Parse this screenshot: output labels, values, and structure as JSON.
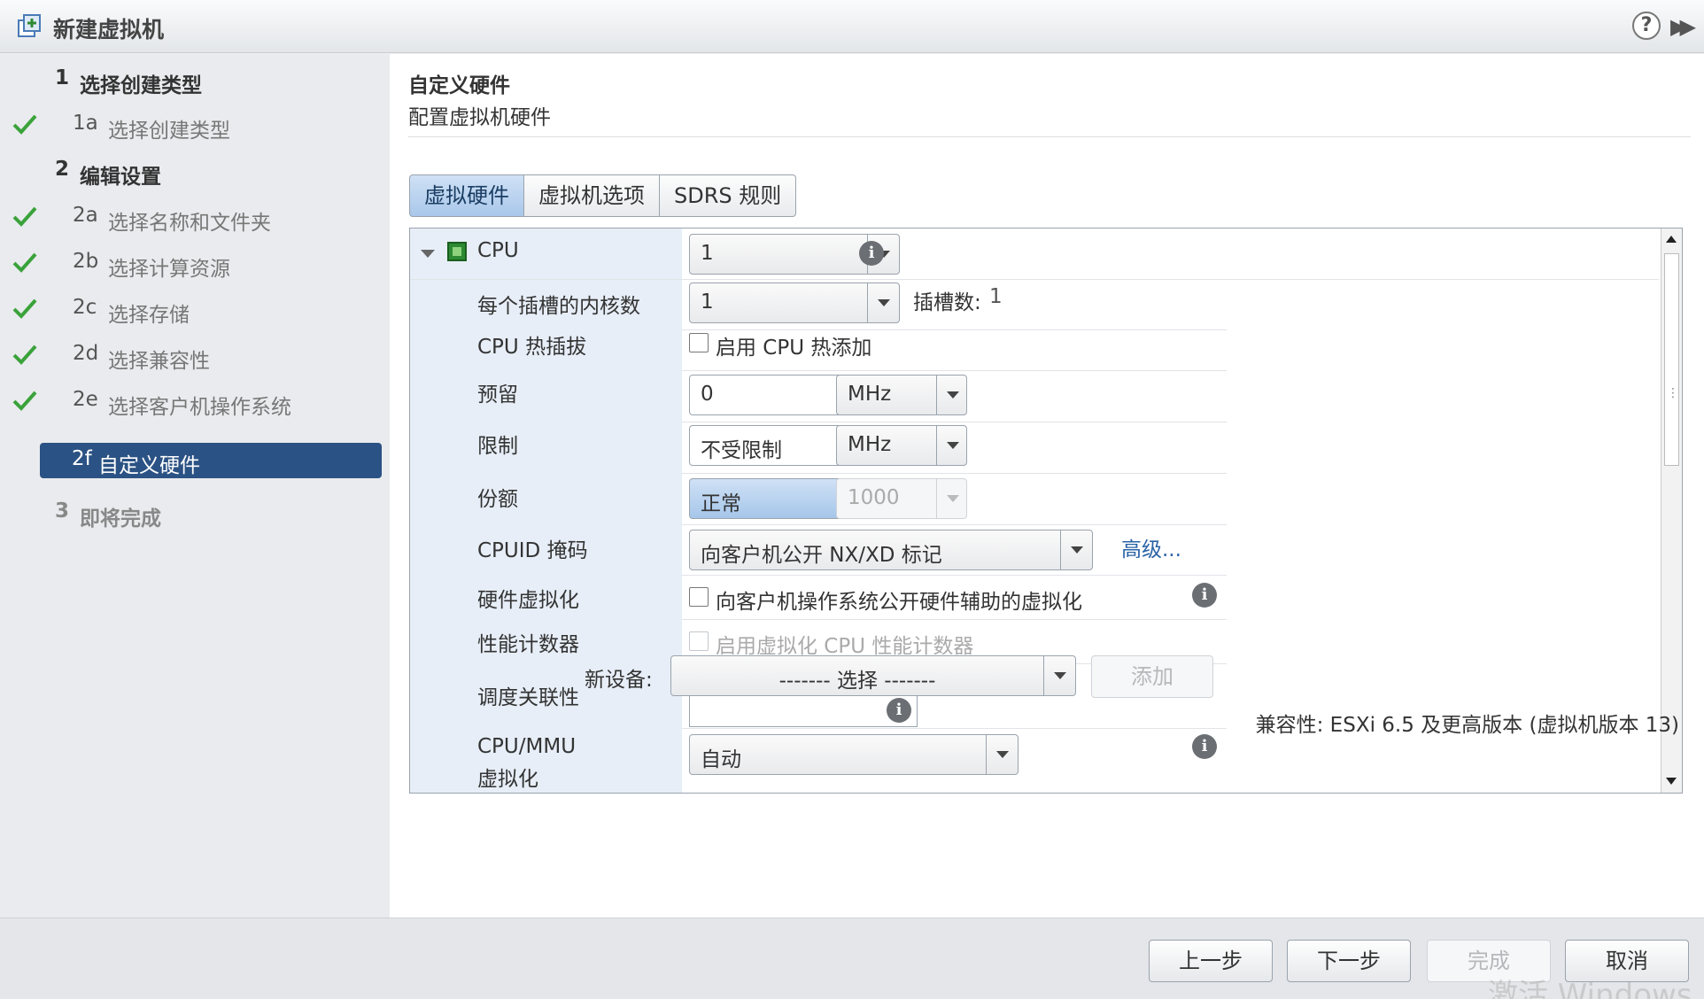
{
  "window": {
    "title": "新建虚拟机",
    "help_icon": "question-icon",
    "expand_icon": "double-chevron-right-icon"
  },
  "nav": {
    "steps": [
      {
        "num": "1",
        "label": "选择创建类型"
      },
      {
        "num": "1a",
        "label": "选择创建类型",
        "completed": true
      },
      {
        "num": "2",
        "label": "编辑设置"
      },
      {
        "num": "2a",
        "label": "选择名称和文件夹",
        "completed": true
      },
      {
        "num": "2b",
        "label": "选择计算资源",
        "completed": true
      },
      {
        "num": "2c",
        "label": "选择存储",
        "completed": true
      },
      {
        "num": "2d",
        "label": "选择兼容性",
        "completed": true
      },
      {
        "num": "2e",
        "label": "选择客户机操作系统",
        "completed": true
      },
      {
        "num": "2f",
        "label": "自定义硬件",
        "active": true
      },
      {
        "num": "3",
        "label": "即将完成"
      }
    ]
  },
  "header": {
    "title": "自定义硬件",
    "subtitle": "配置虚拟机硬件"
  },
  "tabs": [
    {
      "label": "虚拟硬件",
      "active": true
    },
    {
      "label": "虚拟机选项"
    },
    {
      "label": "SDRS 规则"
    }
  ],
  "cpu": {
    "section_label": "CPU",
    "cpu_value": "1",
    "cores_label": "每个插槽的内核数",
    "cores_value": "1",
    "sockets_label": "插槽数:",
    "sockets_value": "1",
    "hotplug_label": "CPU 热插拔",
    "hotplug_checkbox": "启用 CPU 热添加",
    "reservation_label": "预留",
    "reservation_value": "0",
    "reservation_unit": "MHz",
    "limit_label": "限制",
    "limit_value": "不受限制",
    "limit_unit": "MHz",
    "shares_label": "份额",
    "shares_value": "正常",
    "shares_number": "1000",
    "cpuid_label": "CPUID 掩码",
    "cpuid_value": "向客户机公开 NX/XD 标记",
    "cpuid_advanced": "高级...",
    "hwvirt_label": "硬件虚拟化",
    "hwvirt_checkbox": "向客户机操作系统公开硬件辅助的虚拟化",
    "perfcounter_label": "性能计数器",
    "perfcounter_checkbox": "启用虚拟化 CPU 性能计数器",
    "affinity_label": "调度关联性",
    "affinity_value": "",
    "mmu_label_line1": "CPU/MMU",
    "mmu_label_line2": "虚拟化",
    "mmu_value": "自动"
  },
  "new_device": {
    "label": "新设备:",
    "select_value": "------- 选择 -------",
    "add_button": "添加"
  },
  "compatibility": "兼容性: ESXi 6.5 及更高版本 (虚拟机版本 13)",
  "footer": {
    "back": "上一步",
    "next": "下一步",
    "finish": "完成",
    "cancel": "取消"
  },
  "watermark": "激活 Windows",
  "colors": {
    "accent": "#2b5284",
    "check": "#3aa23a",
    "link": "#2a63a6"
  }
}
